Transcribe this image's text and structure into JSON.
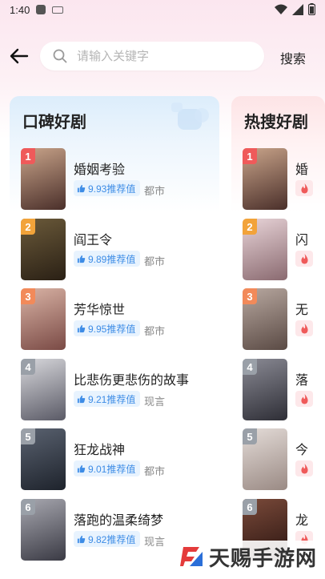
{
  "status": {
    "time": "1:40"
  },
  "search": {
    "placeholder": "请输入关键字",
    "button": "搜索"
  },
  "panels": [
    {
      "title": "口碑好剧",
      "items": [
        {
          "rank": "1",
          "title": "婚姻考验",
          "score": "9.93推荐值",
          "genre": "都市",
          "rank_color": "#ef5a5a",
          "poster_colors": [
            "#c9a48a",
            "#4a2f2a"
          ]
        },
        {
          "rank": "2",
          "title": "阎王令",
          "score": "9.89推荐值",
          "genre": "都市",
          "rank_color": "#f2a33a",
          "poster_colors": [
            "#6b5a3a",
            "#2a2015"
          ]
        },
        {
          "rank": "3",
          "title": "芳华惊世",
          "score": "9.95推荐值",
          "genre": "都市",
          "rank_color": "#f28a5a",
          "poster_colors": [
            "#d9b3a5",
            "#7a4a45"
          ]
        },
        {
          "rank": "4",
          "title": "比悲伤更悲伤的故事",
          "score": "9.21推荐值",
          "genre": "现言",
          "rank_color": "#9aa0a8",
          "poster_colors": [
            "#d8d8dc",
            "#5a5a66"
          ]
        },
        {
          "rank": "5",
          "title": "狂龙战神",
          "score": "9.01推荐值",
          "genre": "都市",
          "rank_color": "#9aa0a8",
          "poster_colors": [
            "#5a6270",
            "#1e232c"
          ]
        },
        {
          "rank": "6",
          "title": "落跑的温柔绮梦",
          "score": "9.82推荐值",
          "genre": "现言",
          "rank_color": "#9aa0a8",
          "poster_colors": [
            "#a8a8b0",
            "#3a3a44"
          ]
        }
      ]
    },
    {
      "title": "热搜好剧",
      "items": [
        {
          "rank": "1",
          "title": "婚",
          "rank_color": "#ef5a5a",
          "poster_colors": [
            "#c9a48a",
            "#4a2f2a"
          ]
        },
        {
          "rank": "2",
          "title": "闪",
          "rank_color": "#f2a33a",
          "poster_colors": [
            "#e8d4d8",
            "#8a6a70"
          ]
        },
        {
          "rank": "3",
          "title": "无",
          "rank_color": "#f28a5a",
          "poster_colors": [
            "#b8a8a0",
            "#5a4a44"
          ]
        },
        {
          "rank": "4",
          "title": "落",
          "rank_color": "#9aa0a8",
          "poster_colors": [
            "#8a8a94",
            "#2e2e36"
          ]
        },
        {
          "rank": "5",
          "title": "今",
          "rank_color": "#9aa0a8",
          "poster_colors": [
            "#e4dcd8",
            "#9a8a84"
          ]
        },
        {
          "rank": "6",
          "title": "龙",
          "rank_color": "#9aa0a8",
          "poster_colors": [
            "#7a4a3a",
            "#2a1410"
          ]
        }
      ]
    }
  ],
  "watermark": {
    "text": "天赐手游网"
  },
  "icons": {
    "back": "back-arrow-icon",
    "search": "search-icon",
    "thumb": "thumbs-up-icon",
    "flame": "flame-icon"
  }
}
